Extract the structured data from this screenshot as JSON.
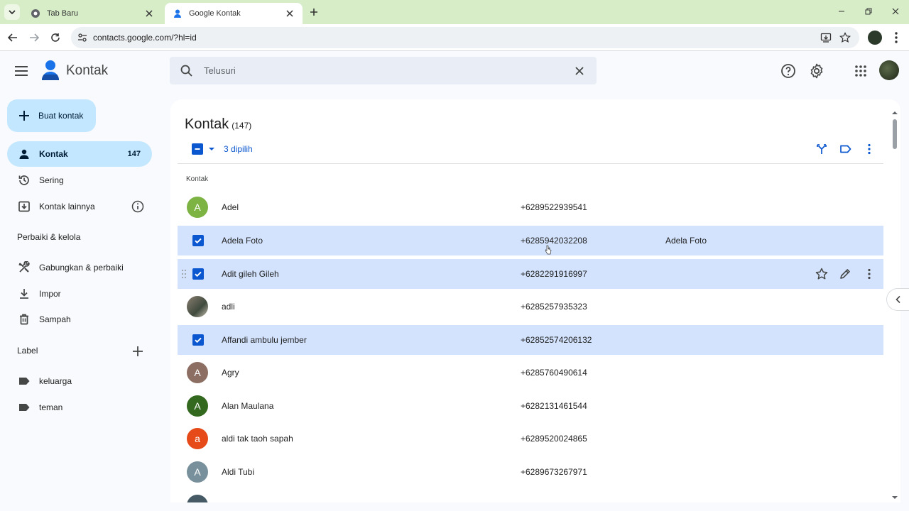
{
  "browser": {
    "tabs": [
      {
        "title": "Tab Baru",
        "active": false
      },
      {
        "title": "Google Kontak",
        "active": true
      }
    ],
    "url": "contacts.google.com/?hl=id"
  },
  "header": {
    "app_title": "Kontak",
    "search_placeholder": "Telusuri"
  },
  "sidebar": {
    "create_label": "Buat kontak",
    "items": [
      {
        "label": "Kontak",
        "count": "147",
        "icon": "person-icon"
      },
      {
        "label": "Sering",
        "icon": "history-icon"
      },
      {
        "label": "Kontak lainnya",
        "icon": "download-box-icon"
      }
    ],
    "manage_heading": "Perbaiki & kelola",
    "manage_items": [
      {
        "label": "Gabungkan & perbaiki",
        "icon": "tools-icon"
      },
      {
        "label": "Impor",
        "icon": "import-icon"
      },
      {
        "label": "Sampah",
        "icon": "trash-icon"
      }
    ],
    "label_heading": "Label",
    "labels": [
      {
        "label": "keluarga",
        "icon": "label-icon"
      },
      {
        "label": "teman",
        "icon": "label-icon"
      }
    ]
  },
  "main": {
    "title": "Kontak",
    "count": "(147)",
    "selected_text": "3 dipilih",
    "list_heading": "Kontak",
    "contacts": [
      {
        "initial": "A",
        "name": "Adel",
        "phone": "+6289522939541",
        "extra": "",
        "selected": false,
        "color": "#7cb342"
      },
      {
        "initial": "",
        "name": "Adela Foto",
        "phone": "+6285942032208",
        "extra": "Adela Foto",
        "selected": true,
        "color": ""
      },
      {
        "initial": "",
        "name": "Adit gileh Gileh",
        "phone": "+6282291916997",
        "extra": "",
        "selected": true,
        "color": ""
      },
      {
        "initial": "",
        "name": "adli",
        "phone": "+6285257935323",
        "extra": "",
        "selected": false,
        "color": "photo"
      },
      {
        "initial": "",
        "name": "Affandi ambulu jember",
        "phone": "+62852574206132",
        "extra": "",
        "selected": true,
        "color": ""
      },
      {
        "initial": "A",
        "name": "Agry",
        "phone": "+6285760490614",
        "extra": "",
        "selected": false,
        "color": "#8d6e63"
      },
      {
        "initial": "A",
        "name": "Alan Maulana",
        "phone": "+6282131461544",
        "extra": "",
        "selected": false,
        "color": "#33691e"
      },
      {
        "initial": "a",
        "name": "aldi tak taoh sapah",
        "phone": "+6289520024865",
        "extra": "",
        "selected": false,
        "color": "#e64a19"
      },
      {
        "initial": "A",
        "name": "Aldi Tubi",
        "phone": "+6289673267971",
        "extra": "",
        "selected": false,
        "color": "#78909c"
      }
    ]
  },
  "colors": {
    "accent": "#0b57d0",
    "selected_row": "#d3e3fd",
    "nav_active": "#c2e7ff"
  }
}
